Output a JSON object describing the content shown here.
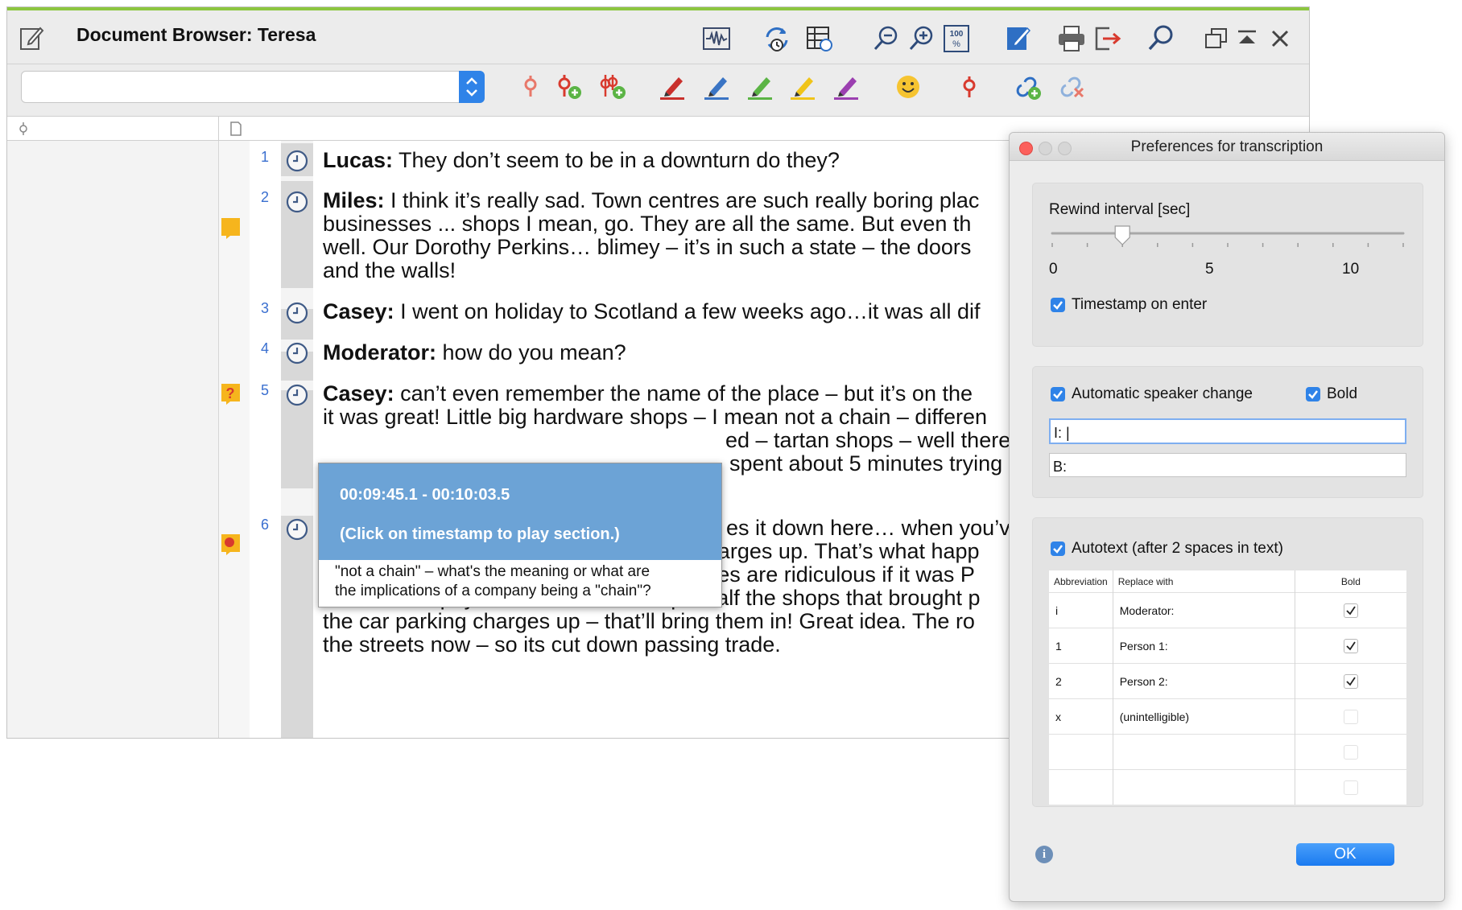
{
  "window": {
    "title": "Document Browser: Teresa",
    "accent_color": "#8cc63f",
    "toolbar_icons": [
      "audio-waveform-icon",
      "sync-media-icon",
      "table-timestamp-icon",
      "zoom-out-icon",
      "zoom-in-icon",
      "zoom-100-icon",
      "edit-mode-icon",
      "print-icon",
      "export-icon",
      "search-icon",
      "float-window-icon",
      "minimize-icon",
      "close-icon"
    ],
    "coding_icons": [
      "code-icon",
      "add-code-icon",
      "add-codes-icon",
      "red-highlighter-icon",
      "blue-highlighter-icon",
      "green-highlighter-icon",
      "yellow-highlighter-icon",
      "magenta-highlighter-icon",
      "emoticon-icon",
      "link-icon",
      "add-link-icon",
      "remove-link-icon"
    ],
    "combo_value": ""
  },
  "transcript": {
    "paragraphs": [
      {
        "num": "1",
        "lines": [
          {
            "speaker": "Lucas:",
            "text": " They don’t seem to be in a downturn do they?"
          }
        ]
      },
      {
        "num": "2",
        "lines": [
          {
            "speaker": "Miles:",
            "text": " I think it’s really sad.  Town centres are such really boring plac"
          },
          {
            "text": "businesses ... shops I mean, go.  They are all the same.  But even th"
          },
          {
            "text": "well.  Our Dorothy Perkins… blimey – it’s in such a state – the doors"
          },
          {
            "text": "and the walls!"
          }
        ]
      },
      {
        "num": "3",
        "lines": [
          {
            "speaker": "Casey:",
            "text": " I went on holiday to Scotland a few weeks ago…it was all dif"
          }
        ]
      },
      {
        "num": "4",
        "lines": [
          {
            "speaker": "Moderator:",
            "text": " how do you mean?"
          }
        ]
      },
      {
        "num": "5",
        "lines": [
          {
            "speaker": "Casey:",
            "text": " can’t even remember the name of the place – but it’s on the"
          },
          {
            "text": "it was great! Little big hardware shops – I mean not a chain – differen"
          },
          {
            "text": "ed – tartan shops – well there"
          },
          {
            "text": "spent about 5 minutes trying"
          }
        ]
      },
      {
        "num": "6",
        "lines": [
          {
            "text": "es it down here… when you’v"
          },
          {
            "text": "the last thing you do is put the parking charges up.  That’s what happ"
          },
          {
            "text": "Council sold the car parks to NCP.  Charges are ridiculous if it was P"
          },
          {
            "text": "not – who’d pay to come to this dump? Half the shops that brought p"
          },
          {
            "text": "the car parking charges up – that’ll bring them in! Great idea.  The ro"
          },
          {
            "text": "the streets now – so its cut down passing trade."
          }
        ]
      }
    ],
    "tooltip": {
      "time": "00:09:45.1 - 00:10:03.5",
      "hint": "(Click on timestamp to play section.)",
      "note_line1": "\"not a chain\" – what's the meaning or what are",
      "note_line2": "the implications of a company being a \"chain\"?"
    },
    "memo_colors": {
      "memo": "#f6b51d",
      "question": "#f6b51d",
      "dot": "#d83a2e"
    }
  },
  "prefs": {
    "title": "Preferences for transcription",
    "rewind_label": "Rewind interval [sec]",
    "slider_min": "0",
    "slider_mid": "5",
    "slider_max": "10",
    "rewind_value_sec": 2,
    "timestamp_on_enter": "Timestamp on enter",
    "auto_speaker": "Automatic speaker change",
    "bold_label": "Bold",
    "speaker_field_1": "I: |",
    "speaker_field_2": "B:",
    "autotext_label": "Autotext (after 2 spaces in text)",
    "table": {
      "headers": [
        "Abbreviation",
        "Replace with",
        "Bold"
      ],
      "rows": [
        {
          "abbr": "i",
          "replace": "Moderator:",
          "bold": true
        },
        {
          "abbr": "1",
          "replace": "Person 1:",
          "bold": true
        },
        {
          "abbr": "2",
          "replace": "Person 2:",
          "bold": true
        },
        {
          "abbr": "x",
          "replace": "(unintelligible)",
          "bold": false
        },
        {
          "abbr": "",
          "replace": "",
          "bold": false
        },
        {
          "abbr": "",
          "replace": "",
          "bold": false
        }
      ]
    },
    "ok_label": "OK",
    "info_label": "i"
  }
}
